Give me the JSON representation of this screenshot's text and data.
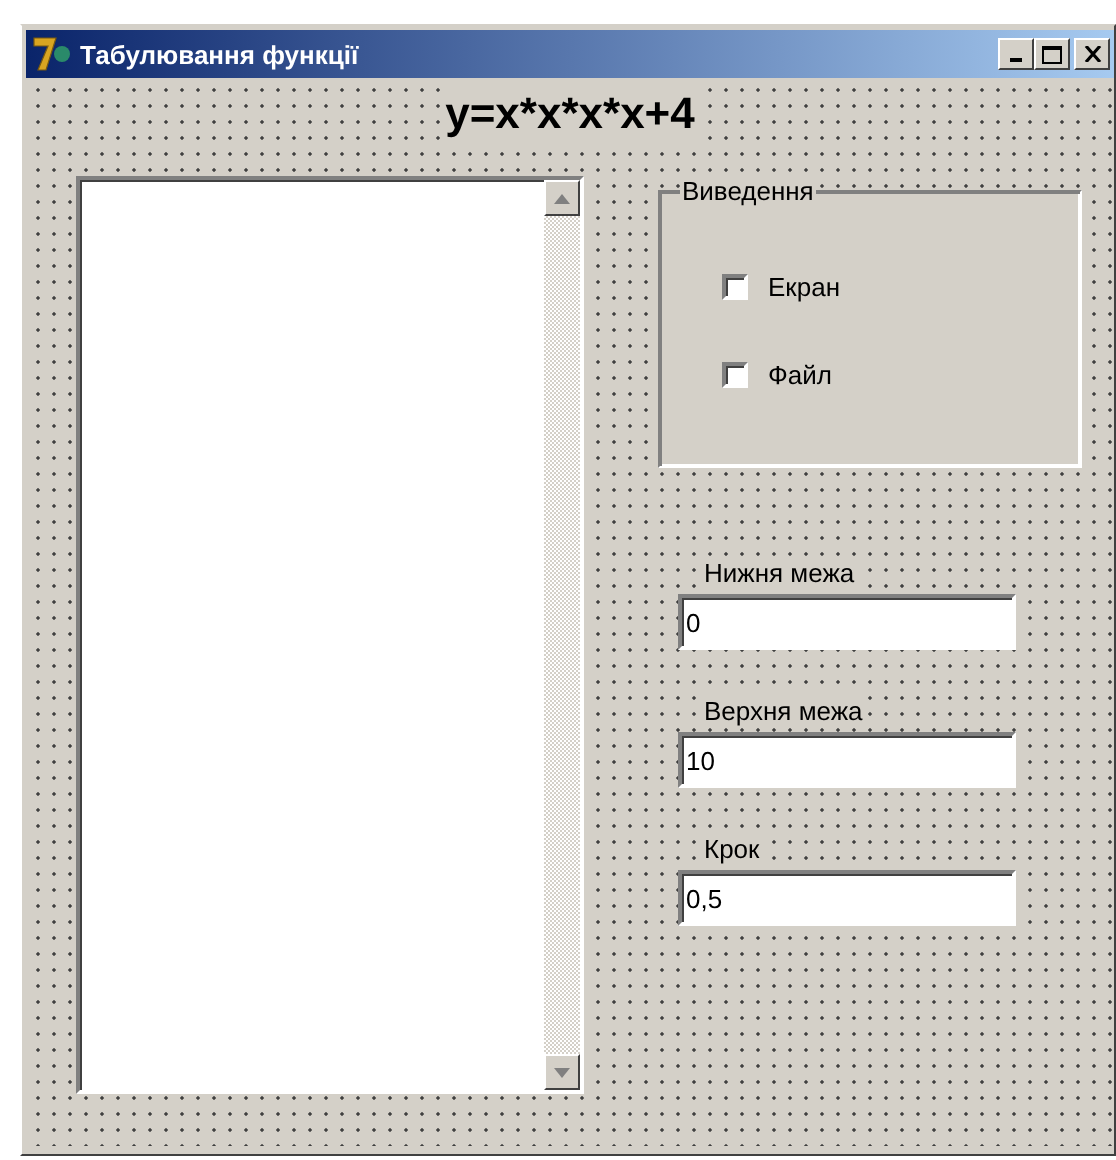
{
  "window": {
    "title": "Табулювання функції"
  },
  "formula": "y=x*x*x*x+4",
  "output_group": {
    "title": "Виведення",
    "options": [
      {
        "label": "Екран",
        "checked": false
      },
      {
        "label": "Файл",
        "checked": false
      }
    ]
  },
  "fields": [
    {
      "label": "Нижня межа",
      "value": "0"
    },
    {
      "label": "Верхня межа",
      "value": "10"
    },
    {
      "label": "Крок",
      "value": "0,5"
    }
  ]
}
